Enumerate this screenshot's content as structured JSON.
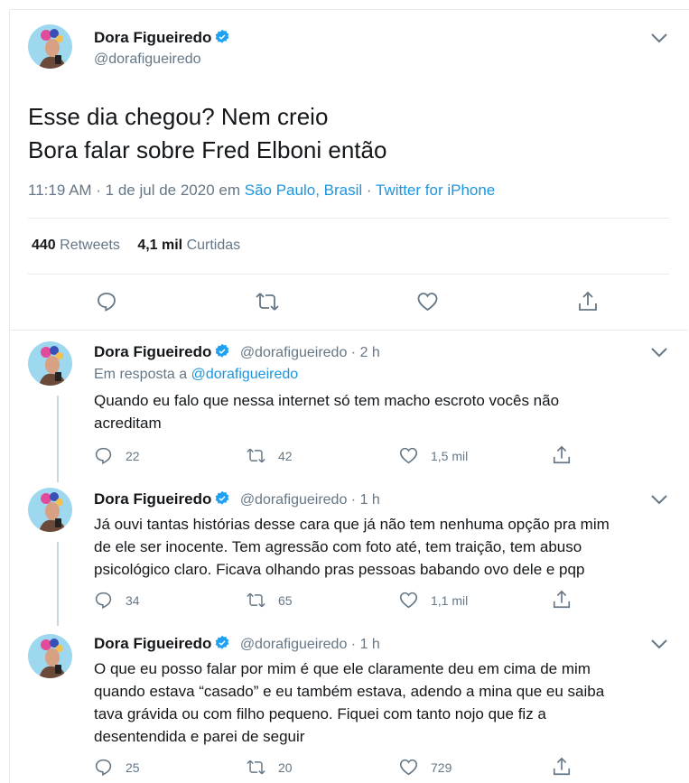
{
  "main": {
    "name": "Dora Figueiredo",
    "handle": "@dorafigueiredo",
    "text_line1": "Esse dia chegou? Nem creio",
    "text_line2": "Bora falar sobre Fred Elboni então",
    "time": "11:19 AM · 1 de jul de 2020 em",
    "location": "São Paulo, Brasil",
    "dot": "·",
    "source": "Twitter for iPhone",
    "retweets_count": "440",
    "retweets_label": "Retweets",
    "likes_count": "4,1 mil",
    "likes_label": "Curtidas"
  },
  "replies": [
    {
      "name": "Dora Figueiredo",
      "handle": "@dorafigueiredo · 2 h",
      "reply_prefix": "Em resposta a",
      "reply_to": "@dorafigueiredo",
      "lines": [
        "Quando eu falo que nessa internet só tem macho escroto vocês não",
        "acreditam"
      ],
      "replies": "22",
      "retweets": "42",
      "likes": "1,5 mil"
    },
    {
      "name": "Dora Figueiredo",
      "handle": "@dorafigueiredo · 1 h",
      "lines": [
        "Já ouvi tantas histórias desse cara que já não tem nenhuma opção pra mim",
        "de ele ser inocente. Tem agressão com foto até, tem traição, tem abuso",
        "psicológico claro. Ficava olhando pras pessoas babando ovo dele e pqp"
      ],
      "replies": "34",
      "retweets": "65",
      "likes": "1,1 mil"
    },
    {
      "name": "Dora Figueiredo",
      "handle": "@dorafigueiredo · 1 h",
      "lines": [
        "O que eu posso falar por mim é que ele claramente deu em cima de mim",
        "quando estava “casado” e eu também estava, adendo a mina que eu saiba",
        "tava grávida ou com filho pequeno. Fiquei com tanto nojo que fiz a",
        "desentendida e parei de seguir"
      ],
      "replies": "25",
      "retweets": "20",
      "likes": "729"
    }
  ],
  "colors": {
    "link": "#1b95e0",
    "secondary": "#657786",
    "verified": "#1da1f2",
    "thread_line": "#ccd6dd"
  }
}
